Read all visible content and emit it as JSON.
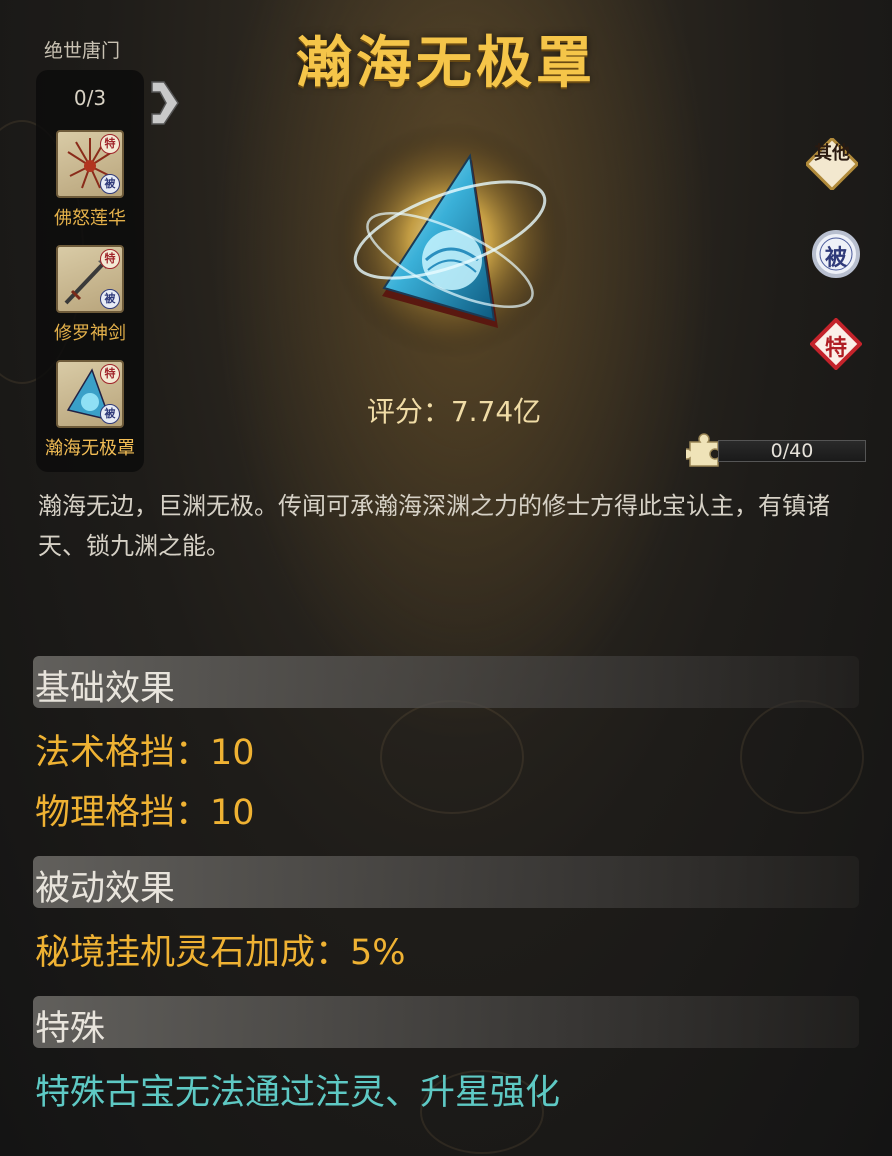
{
  "set": {
    "name": "绝世唐门",
    "count": "0/3",
    "items": [
      {
        "label": "佛怒莲华",
        "badge_special": "特",
        "badge_passive": "被"
      },
      {
        "label": "修罗神剑",
        "badge_special": "特",
        "badge_passive": "被"
      },
      {
        "label": "瀚海无极罩",
        "badge_special": "特",
        "badge_passive": "被"
      }
    ]
  },
  "item": {
    "title": "瀚海无极罩",
    "score": "评分：7.74亿",
    "description": "瀚海无边，巨渊无极。传闻可承瀚海深渊之力的修士方得此宝认主，有镇诸天、锁九渊之能。"
  },
  "tags": {
    "other": "其他",
    "passive": "被",
    "special": "特"
  },
  "fragments": {
    "text": "0/40",
    "progress": 0
  },
  "sections": {
    "basic": {
      "header": "基础效果",
      "effects": [
        "法术格挡：10",
        "物理格挡：10"
      ]
    },
    "passive": {
      "header": "被动效果",
      "effects": [
        "秘境挂机灵石加成：5%"
      ]
    },
    "special": {
      "header": "特殊",
      "effects": [
        "特殊古宝无法通过注灵、升星强化"
      ]
    }
  },
  "colors": {
    "title": "#f5c549",
    "effect_gold": "#efb233",
    "effect_teal": "#5ec9c4"
  }
}
